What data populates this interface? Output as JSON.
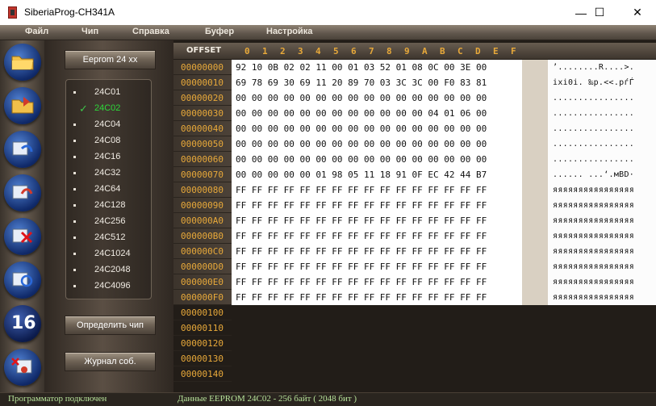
{
  "window": {
    "title": "SiberiaProg-CH341A",
    "controls": {
      "minimize": "—",
      "maximize": "☐",
      "close": "✕"
    }
  },
  "menu": [
    "Файл",
    "Чип",
    "Справка",
    "Буфер",
    "Настройка"
  ],
  "toolbar": {
    "icons": [
      "open-folder-icon",
      "save-folder-icon",
      "read-chip-icon",
      "write-chip-icon",
      "erase-chip-icon",
      "verify-chip-icon",
      "hex-16-icon",
      "blank-check-icon"
    ],
    "hex16_label": "16"
  },
  "chip_panel": {
    "family_button": "Eeprom 24 xx",
    "chips": [
      "24C01",
      "24C02",
      "24C04",
      "24C08",
      "24C16",
      "24C32",
      "24C64",
      "24C128",
      "24C256",
      "24C512",
      "24C1024",
      "24C2048",
      "24C4096"
    ],
    "selected": "24C02",
    "detect_button": "Определить чип",
    "log_button": "Журнал соб."
  },
  "hex": {
    "offset_label": "OFFSET",
    "columns": [
      "0",
      "1",
      "2",
      "3",
      "4",
      "5",
      "6",
      "7",
      "8",
      "9",
      "A",
      "B",
      "C",
      "D",
      "E",
      "F"
    ],
    "rows": [
      {
        "addr": "00000000",
        "hex": "92 10 0B 02 02 11 00 01 03 52 01 08 0C 00 3E 00",
        "ascii": "’........R....>."
      },
      {
        "addr": "00000010",
        "hex": "69 78 69 30 69 11 20 89 70 03 3C 3C 00 F0 83 81",
        "ascii": "ixi0i. ‰p.<<.рѓЃ"
      },
      {
        "addr": "00000020",
        "hex": "00 00 00 00 00 00 00 00 00 00 00 00 00 00 00 00",
        "ascii": "................"
      },
      {
        "addr": "00000030",
        "hex": "00 00 00 00 00 00 00 00 00 00 00 00 04 01 06 00",
        "ascii": "................"
      },
      {
        "addr": "00000040",
        "hex": "00 00 00 00 00 00 00 00 00 00 00 00 00 00 00 00",
        "ascii": "................"
      },
      {
        "addr": "00000050",
        "hex": "00 00 00 00 00 00 00 00 00 00 00 00 00 00 00 00",
        "ascii": "................"
      },
      {
        "addr": "00000060",
        "hex": "00 00 00 00 00 00 00 00 00 00 00 00 00 00 00 00",
        "ascii": "................"
      },
      {
        "addr": "00000070",
        "hex": "00 00 00 00 00 01 98 05 11 18 91 0F EC 42 44 B7",
        "ascii": "...... ...‘.мBD·"
      },
      {
        "addr": "00000080",
        "hex": "FF FF FF FF FF FF FF FF FF FF FF FF FF FF FF FF",
        "ascii": "яяяяяяяяяяяяяяяя"
      },
      {
        "addr": "00000090",
        "hex": "FF FF FF FF FF FF FF FF FF FF FF FF FF FF FF FF",
        "ascii": "яяяяяяяяяяяяяяяя"
      },
      {
        "addr": "000000A0",
        "hex": "FF FF FF FF FF FF FF FF FF FF FF FF FF FF FF FF",
        "ascii": "яяяяяяяяяяяяяяяя"
      },
      {
        "addr": "000000B0",
        "hex": "FF FF FF FF FF FF FF FF FF FF FF FF FF FF FF FF",
        "ascii": "яяяяяяяяяяяяяяяя"
      },
      {
        "addr": "000000C0",
        "hex": "FF FF FF FF FF FF FF FF FF FF FF FF FF FF FF FF",
        "ascii": "яяяяяяяяяяяяяяяя"
      },
      {
        "addr": "000000D0",
        "hex": "FF FF FF FF FF FF FF FF FF FF FF FF FF FF FF FF",
        "ascii": "яяяяяяяяяяяяяяяя"
      },
      {
        "addr": "000000E0",
        "hex": "FF FF FF FF FF FF FF FF FF FF FF FF FF FF FF FF",
        "ascii": "яяяяяяяяяяяяяяяя"
      },
      {
        "addr": "000000F0",
        "hex": "FF FF FF FF FF FF FF FF FF FF FF FF FF FF FF FF",
        "ascii": "яяяяяяяяяяяяяяяя"
      }
    ],
    "empty_rows": [
      "00000100",
      "00000110",
      "00000120",
      "00000130",
      "00000140"
    ]
  },
  "status": {
    "connection": "Программатор подключен",
    "info": "Данные EEPROM  24C02 - 256 байт ( 2048 бит )"
  },
  "colors": {
    "offset_orange": "#e8a93a",
    "selected_chip": "#2dd83a",
    "status_green": "#b7e39a"
  }
}
